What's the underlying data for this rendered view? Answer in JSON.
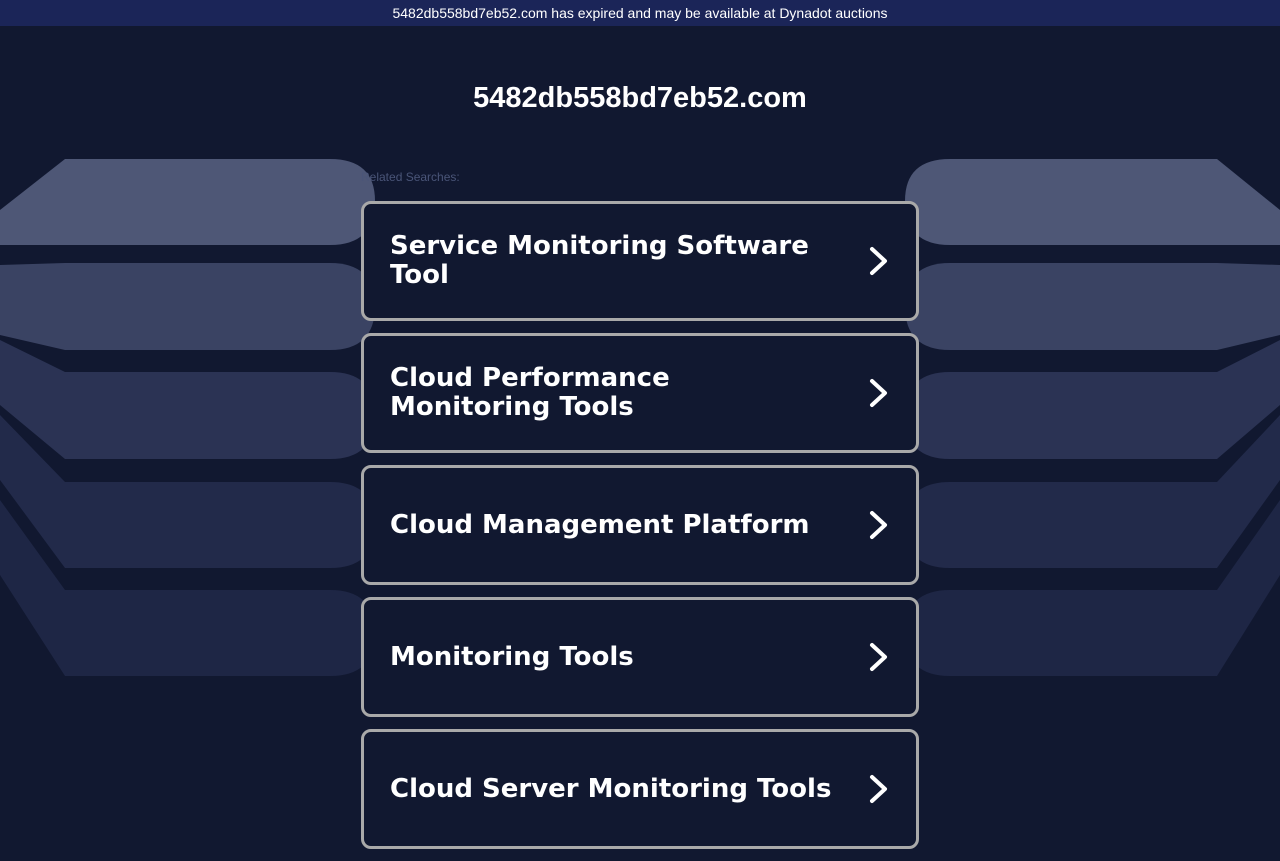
{
  "banner": {
    "text": "5482db558bd7eb52.com has expired and may be available at Dynadot auctions"
  },
  "page": {
    "domain": "5482db558bd7eb52.com",
    "related_label": "Related Searches:"
  },
  "results": [
    {
      "label": "Service Monitoring Software Tool"
    },
    {
      "label": "Cloud Performance Monitoring Tools"
    },
    {
      "label": "Cloud Management Platform"
    },
    {
      "label": "Monitoring Tools"
    },
    {
      "label": "Cloud Server Monitoring Tools"
    }
  ],
  "colors": {
    "background": "#111830",
    "banner": "#1b2558",
    "card_border": "#a9a9a9",
    "text": "#ffffff"
  },
  "icons": {
    "result_arrow": "chevron-right-icon"
  }
}
